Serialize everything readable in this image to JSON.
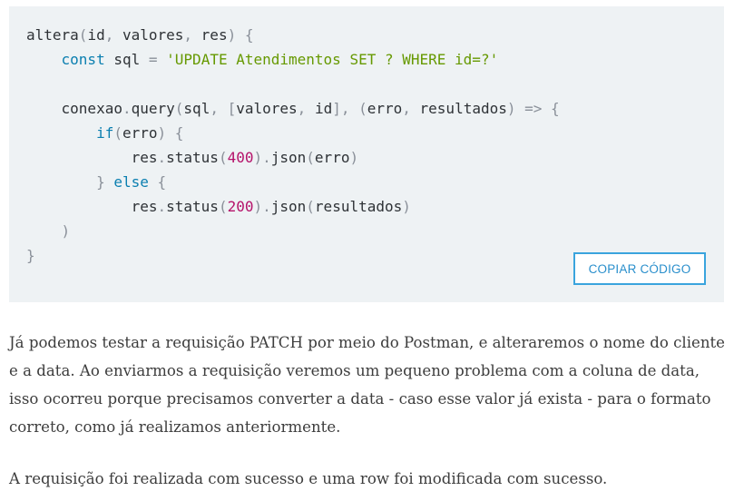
{
  "code": {
    "lines": [
      [
        [
          "tx",
          "altera"
        ],
        [
          "p",
          "("
        ],
        [
          "tx",
          "id"
        ],
        [
          "p",
          ", "
        ],
        [
          "tx",
          "valores"
        ],
        [
          "p",
          ", "
        ],
        [
          "tx",
          "res"
        ],
        [
          "p",
          ") {"
        ]
      ],
      [
        [
          "tx",
          "    "
        ],
        [
          "kw",
          "const"
        ],
        [
          "tx",
          " sql "
        ],
        [
          "p",
          "="
        ],
        [
          "tx",
          " "
        ],
        [
          "st",
          "'UPDATE Atendimentos SET ? WHERE id=?'"
        ]
      ],
      [],
      [
        [
          "tx",
          "    conexao"
        ],
        [
          "p",
          "."
        ],
        [
          "tx",
          "query"
        ],
        [
          "p",
          "("
        ],
        [
          "tx",
          "sql"
        ],
        [
          "p",
          ", ["
        ],
        [
          "tx",
          "valores"
        ],
        [
          "p",
          ", "
        ],
        [
          "tx",
          "id"
        ],
        [
          "p",
          "], ("
        ],
        [
          "tx",
          "erro"
        ],
        [
          "p",
          ", "
        ],
        [
          "tx",
          "resultados"
        ],
        [
          "p",
          ") => {"
        ]
      ],
      [
        [
          "tx",
          "        "
        ],
        [
          "kw",
          "if"
        ],
        [
          "p",
          "("
        ],
        [
          "tx",
          "erro"
        ],
        [
          "p",
          ") {"
        ]
      ],
      [
        [
          "tx",
          "            res"
        ],
        [
          "p",
          "."
        ],
        [
          "tx",
          "status"
        ],
        [
          "p",
          "("
        ],
        [
          "nm",
          "400"
        ],
        [
          "p",
          ")."
        ],
        [
          "tx",
          "json"
        ],
        [
          "p",
          "("
        ],
        [
          "tx",
          "erro"
        ],
        [
          "p",
          ")"
        ]
      ],
      [
        [
          "tx",
          "        "
        ],
        [
          "p",
          "} "
        ],
        [
          "kw",
          "else"
        ],
        [
          "p",
          " {"
        ]
      ],
      [
        [
          "tx",
          "            res"
        ],
        [
          "p",
          "."
        ],
        [
          "tx",
          "status"
        ],
        [
          "p",
          "("
        ],
        [
          "nm",
          "200"
        ],
        [
          "p",
          ")."
        ],
        [
          "tx",
          "json"
        ],
        [
          "p",
          "("
        ],
        [
          "tx",
          "resultados"
        ],
        [
          "p",
          ")"
        ]
      ],
      [
        [
          "tx",
          "    "
        ],
        [
          "p",
          ")"
        ]
      ],
      [
        [
          "p",
          "}"
        ]
      ]
    ],
    "copy_label": "COPIAR CÓDIGO"
  },
  "paragraphs": [
    "Já podemos testar a requisição PATCH por meio do Postman, e alteraremos o nome do cliente e a data. Ao enviarmos a requisição veremos um pequeno problema com a coluna de data, isso ocorreu porque precisamos converter a data - caso esse valor já exista - para o formato correto, como já realizamos anteriormente.",
    "A requisição foi realizada com sucesso e uma row foi modificada com sucesso."
  ],
  "colors": {
    "code_background": "#eef2f4",
    "keyword": "#0b7fb0",
    "string": "#669900",
    "number": "#b5126a",
    "button_border": "#3aa4dd"
  }
}
